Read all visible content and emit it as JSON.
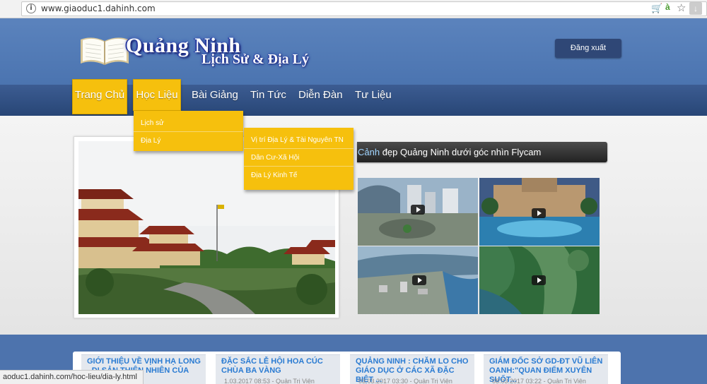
{
  "browser": {
    "url": "www.giaoduc1.dahinh.com",
    "status_url": "aoduc1.dahinh.com/hoc-lieu/dia-ly.html"
  },
  "header": {
    "logo_title": "Quảng Ninh",
    "logo_subtitle": "Lịch Sử & Địa Lý",
    "logout_label": "Đăng xuất"
  },
  "nav": {
    "items": [
      "Trang Chủ",
      "Học Liệu",
      "Bài Giảng",
      "Tin Tức",
      "Diễn Đàn",
      "Tư Liệu"
    ],
    "active": "Học Liệu"
  },
  "dropdown_hoc_lieu": [
    "Lịch sử",
    "Địa Lý"
  ],
  "dropdown_dia_ly": [
    "Vị trí Địa Lý & Tài Nguyên TN",
    "Dân Cư-Xã Hội",
    "Địa Lý Kinh Tế"
  ],
  "video_section": {
    "title_first": "Cảnh",
    "title_rest": " đẹp Quảng Ninh dưới góc nhìn Flycam"
  },
  "news": [
    {
      "title": "GIỚI THIỆU VỀ VỊNH HẠ LONG - DI SẢN THIÊN NHIÊN CỦA",
      "date": ""
    },
    {
      "title": "ĐẶC SẮC LỄ HỘI HOA CÚC CHÙA BA VÀNG",
      "date": "1.03.2017 08:53 - Quản Trị Viên"
    },
    {
      "title": "QUẢNG NINH : CHĂM LO CHO GIÁO DỤC Ở CÁC XÃ ĐẶC BIỆT ...",
      "date": "03.03.2017 03:30 - Quản Trị Viên"
    },
    {
      "title": "GIÁM ĐỐC SỞ GD-ĐT VŨ LIÊN OANH:\"QUAN ĐIỂM XUYÊN SUỐT...",
      "date": "08.03.2017 03:22 - Quản Trị Viên"
    }
  ]
}
